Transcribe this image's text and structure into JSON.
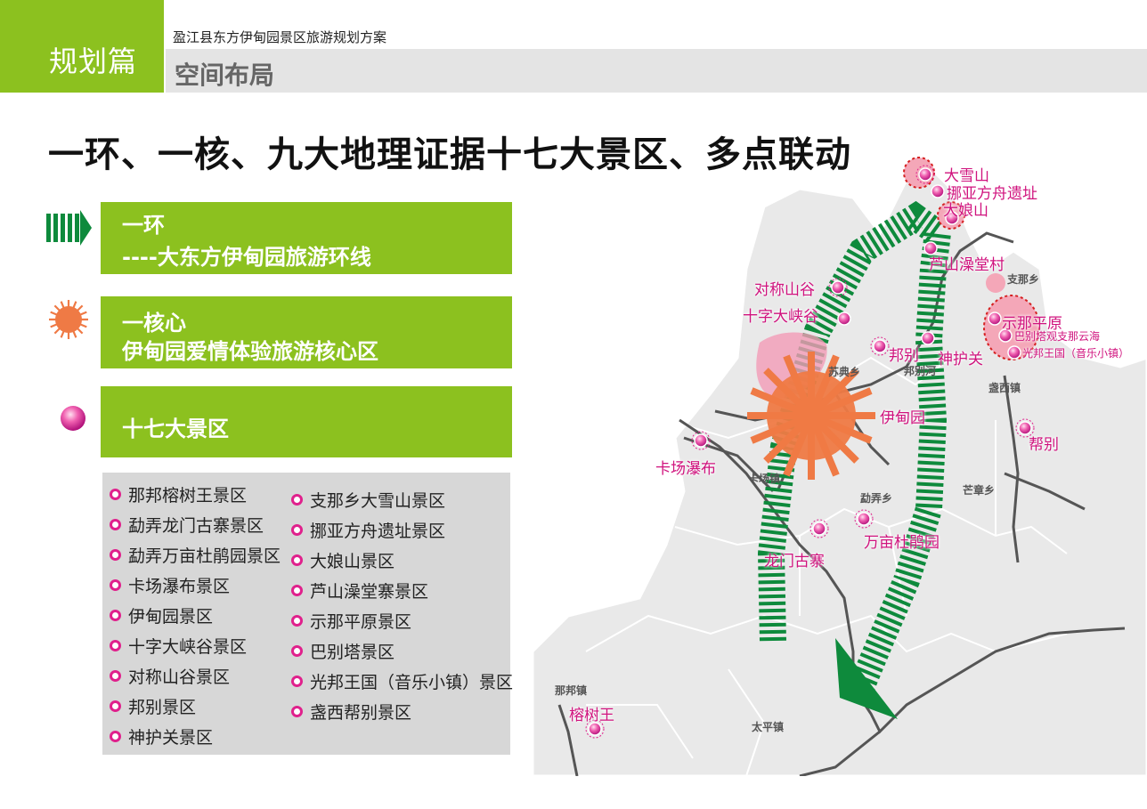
{
  "header": {
    "tag": "规划篇",
    "doc_title": "盈江县东方伊甸园景区旅游规划方案",
    "section": "空间布局"
  },
  "headline": "一环、一核、九大地理证据十七大景区、多点联动",
  "legend": [
    {
      "symbol": "green-arrow-icon",
      "line1": "一环",
      "line2": "----大东方伊甸园旅游环线"
    },
    {
      "symbol": "orange-sun-icon",
      "line1": "一核心",
      "line2": "伊甸园爱情体验旅游核心区"
    },
    {
      "symbol": "pink-dot-icon",
      "line1": "十七大景区",
      "line2": ""
    }
  ],
  "scenic_list": {
    "left": [
      "那邦榕树王景区",
      "勐弄龙门古寨景区",
      "勐弄万亩杜鹃园景区",
      "卡场瀑布景区",
      "伊甸园景区",
      "十字大峡谷景区",
      "对称山谷景区",
      "邦别景区",
      "神护关景区"
    ],
    "right": [
      "支那乡大雪山景区",
      "挪亚方舟遗址景区",
      "大娘山景区",
      "芦山澡堂寨景区",
      "示那平原景区",
      "巴别塔景区",
      "光邦王国（音乐小镇）景区",
      "盏西帮别景区"
    ]
  },
  "map": {
    "spot_labels": {
      "daxueshan": "大雪山",
      "nuoya": "挪亚方舟遗址",
      "daniangshan": "大娘山",
      "lushan": "芦山澡堂村",
      "duichen": "对称山谷",
      "shizi": "十字大峡谷",
      "bangbie": "邦别",
      "shenhu": "神护关",
      "shina": "示那平原",
      "babieta": "巴别塔观支那云海",
      "guangbang": "光邦王国（音乐小镇）",
      "yidian": "伊甸园",
      "bangbie2": "帮别",
      "kachang": "卡场瀑布",
      "dujuan": "万亩杜鹃园",
      "longmen": "龙门古寨",
      "rongshu": "榕树王"
    },
    "town_labels": {
      "zhina": "支那乡",
      "sudian": "苏典乡",
      "bangbiehe": "邦别河",
      "zhanxi": "盏西镇",
      "kachang": "卡场镇",
      "mengnong": "勐弄乡",
      "mangzhang": "芒章乡",
      "nabang": "那邦镇",
      "taiping": "太平镇"
    },
    "colors": {
      "ring": "#0e8a3c",
      "core": "#ef7a45",
      "spot": "#e0208c",
      "label": "#d0137e"
    }
  }
}
